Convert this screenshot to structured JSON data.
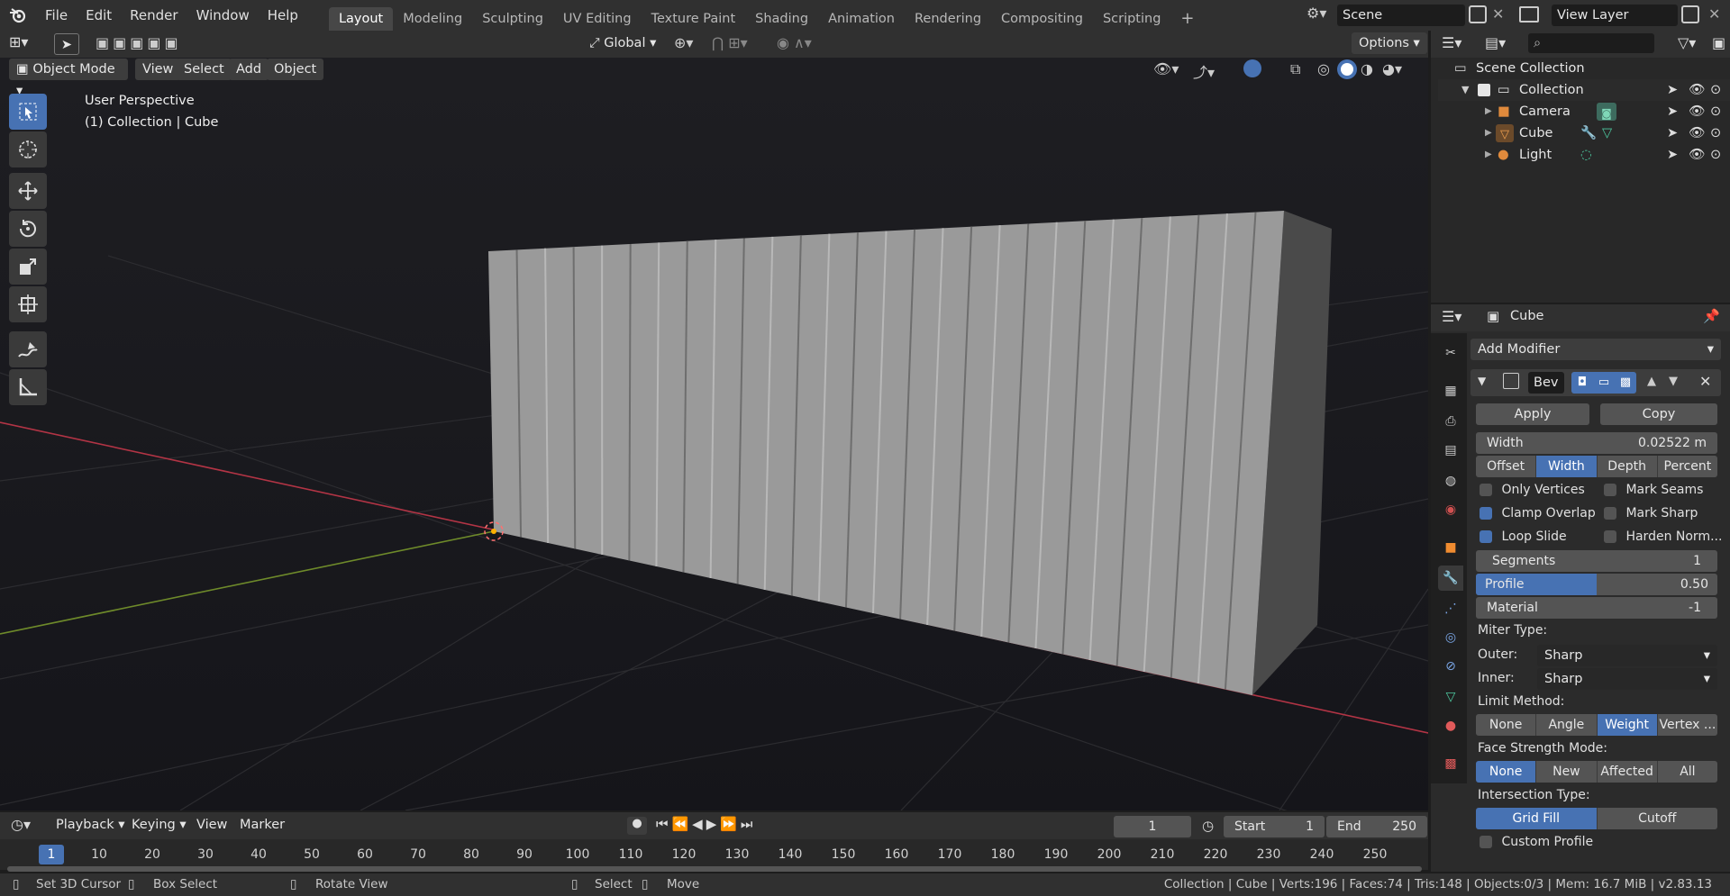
{
  "menus": [
    "File",
    "Edit",
    "Render",
    "Window",
    "Help"
  ],
  "workspaces": [
    "Layout",
    "Modeling",
    "Sculpting",
    "UV Editing",
    "Texture Paint",
    "Shading",
    "Animation",
    "Rendering",
    "Compositing",
    "Scripting"
  ],
  "scene_name": "Scene",
  "view_layer": "View Layer",
  "header": {
    "mode": "Object Mode",
    "menus": [
      "View",
      "Select",
      "Add",
      "Object"
    ],
    "orientation": "Global",
    "options": "Options"
  },
  "viewport": {
    "perspective": "User Perspective",
    "collection_info": "(1) Collection | Cube"
  },
  "outliner": {
    "root": "Scene Collection",
    "collection": "Collection",
    "items": [
      "Camera",
      "Cube",
      "Light"
    ]
  },
  "properties": {
    "object_name": "Cube",
    "add_modifier": "Add Modifier",
    "modifier_name": "Bev",
    "apply": "Apply",
    "copy": "Copy",
    "width_label": "Width",
    "width_value": "0.02522 m",
    "width_types": [
      "Offset",
      "Width",
      "Depth",
      "Percent"
    ],
    "width_type_selected": "Width",
    "checks_left": [
      {
        "label": "Only Vertices",
        "on": false
      },
      {
        "label": "Clamp Overlap",
        "on": true
      },
      {
        "label": "Loop Slide",
        "on": true
      }
    ],
    "checks_right": [
      {
        "label": "Mark Seams",
        "on": false
      },
      {
        "label": "Mark Sharp",
        "on": false
      },
      {
        "label": "Harden Norm...",
        "on": false
      }
    ],
    "segments_label": "Segments",
    "segments_value": "1",
    "profile_label": "Profile",
    "profile_value": "0.50",
    "profile_fraction": 0.5,
    "material_label": "Material",
    "material_value": "-1",
    "miter_type": "Miter Type:",
    "outer_label": "Outer:",
    "outer_value": "Sharp",
    "inner_label": "Inner:",
    "inner_value": "Sharp",
    "limit_method": "Limit Method:",
    "limit_options": [
      "None",
      "Angle",
      "Weight",
      "Vertex ..."
    ],
    "limit_selected": "Weight",
    "face_strength": "Face Strength Mode:",
    "face_options": [
      "None",
      "New",
      "Affected",
      "All"
    ],
    "face_selected": "None",
    "intersection": "Intersection Type:",
    "intersection_options": [
      "Grid Fill",
      "Cutoff"
    ],
    "intersection_selected": "Grid Fill",
    "custom_profile": "Custom Profile"
  },
  "timeline": {
    "menus": [
      "Playback",
      "Keying",
      "View",
      "Marker"
    ],
    "current_frame": "1",
    "start_label": "Start",
    "start": "1",
    "end_label": "End",
    "end": "250",
    "ticks": [
      "1",
      "10",
      "20",
      "30",
      "40",
      "50",
      "60",
      "70",
      "80",
      "90",
      "100",
      "110",
      "120",
      "130",
      "140",
      "150",
      "160",
      "170",
      "180",
      "190",
      "200",
      "210",
      "220",
      "230",
      "240",
      "250"
    ]
  },
  "statusbar": {
    "hints": [
      "Set 3D Cursor",
      "Box Select",
      "Rotate View",
      "Select",
      "Move"
    ],
    "stats": "Collection | Cube | Verts:196 | Faces:74 | Tris:148 | Objects:0/3 | Mem: 16.7 MiB | v2.83.13"
  },
  "colors": {
    "accent": "#4772b3",
    "panel": "#303030",
    "viewport_top": "#3d3d3d",
    "x_axis": "#c23a4a",
    "y_axis": "#7a9b2c"
  }
}
